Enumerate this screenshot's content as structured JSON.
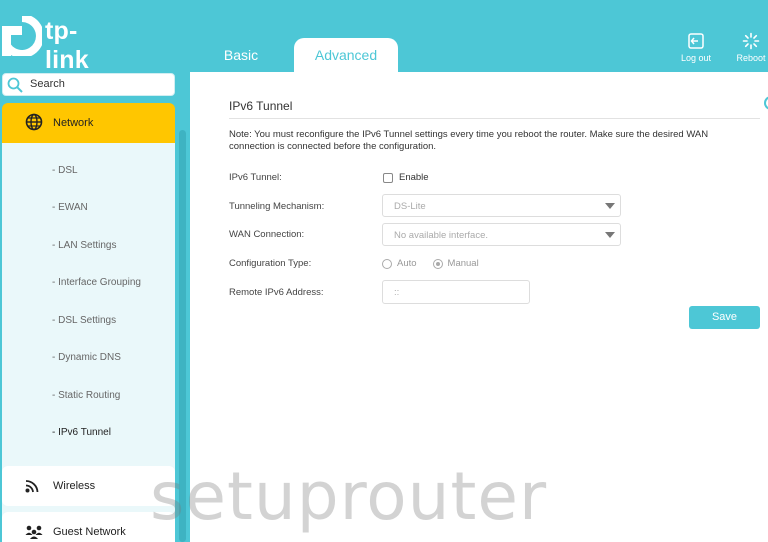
{
  "brand": {
    "name": "tp-link",
    "accent": "#4dc7d6",
    "highlight": "#ffc600"
  },
  "header": {
    "tabs": [
      {
        "label": "Basic"
      },
      {
        "label": "Advanced",
        "active": true
      }
    ],
    "logout_label": "Log out",
    "reboot_label": "Reboot"
  },
  "sidebar": {
    "search_placeholder": "Search",
    "network_label": "Network",
    "sub_items": [
      {
        "label": "- DSL"
      },
      {
        "label": "- EWAN"
      },
      {
        "label": "- LAN Settings"
      },
      {
        "label": "- Interface Grouping"
      },
      {
        "label": "- DSL Settings"
      },
      {
        "label": "- Dynamic DNS"
      },
      {
        "label": "- Static Routing"
      },
      {
        "label": "- IPv6 Tunnel",
        "active": true
      }
    ],
    "wireless_label": "Wireless",
    "guest_label": "Guest Network"
  },
  "main": {
    "title": "IPv6 Tunnel",
    "note": "Note: You must reconfigure the IPv6 Tunnel settings every time you reboot the router. Make sure the desired WAN connection is connected before the configuration.",
    "fields": {
      "ipv6_tunnel_label": "IPv6 Tunnel:",
      "enable_label": "Enable",
      "mechanism_label": "Tunneling Mechanism:",
      "mechanism_value": "DS-Lite",
      "wan_label": "WAN Connection:",
      "wan_value": "No available interface.",
      "config_type_label": "Configuration Type:",
      "auto_label": "Auto",
      "manual_label": "Manual",
      "remote_label": "Remote IPv6 Address:",
      "remote_value": "::"
    },
    "save_label": "Save"
  },
  "watermark": "setuprouter"
}
